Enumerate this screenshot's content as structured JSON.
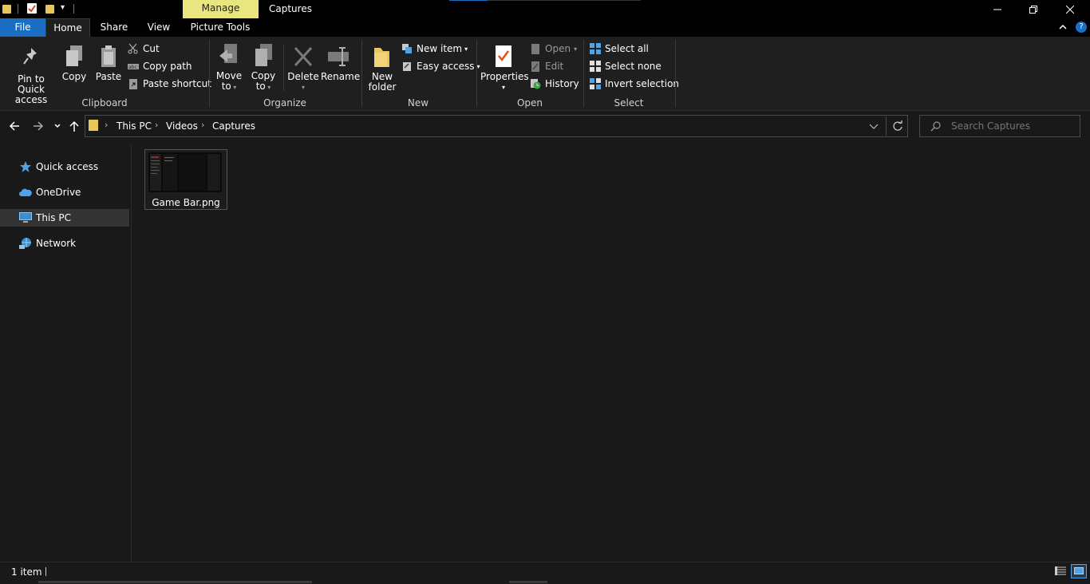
{
  "window": {
    "title": "Captures",
    "contextual_tab_group": "Manage"
  },
  "tabs": [
    "File",
    "Home",
    "Share",
    "View",
    "Picture Tools"
  ],
  "ribbon": {
    "clipboard": {
      "group_label": "Clipboard",
      "pin": "Pin to Quick access",
      "pin_line1": "Pin to Quick",
      "pin_line2": "access",
      "copy": "Copy",
      "paste": "Paste",
      "cut": "Cut",
      "copy_path": "Copy path",
      "paste_shortcut": "Paste shortcut"
    },
    "organize": {
      "group_label": "Organize",
      "move_to_1": "Move",
      "move_to_2": "to",
      "copy_to_1": "Copy",
      "copy_to_2": "to",
      "delete": "Delete",
      "rename": "Rename"
    },
    "new": {
      "group_label": "New",
      "new_folder_1": "New",
      "new_folder_2": "folder",
      "new_item": "New item",
      "easy_access": "Easy access"
    },
    "open": {
      "group_label": "Open",
      "properties": "Properties",
      "open": "Open",
      "edit": "Edit",
      "history": "History"
    },
    "select": {
      "group_label": "Select",
      "select_all": "Select all",
      "select_none": "Select none",
      "invert_selection": "Invert selection"
    }
  },
  "address": {
    "breadcrumbs": [
      "This PC",
      "Videos",
      "Captures"
    ],
    "search_placeholder": "Search Captures"
  },
  "nav": {
    "items": [
      "Quick access",
      "OneDrive",
      "This PC",
      "Network"
    ],
    "selected": "This PC"
  },
  "files": [
    {
      "name": "Game Bar.png"
    }
  ],
  "status": {
    "item_count": "1 item"
  },
  "colors": {
    "file_tab": "#1a6fc3",
    "manage_tab": "#e9e57f",
    "folder": "#e8c65a",
    "accent_icon": "#4fa3e8"
  }
}
